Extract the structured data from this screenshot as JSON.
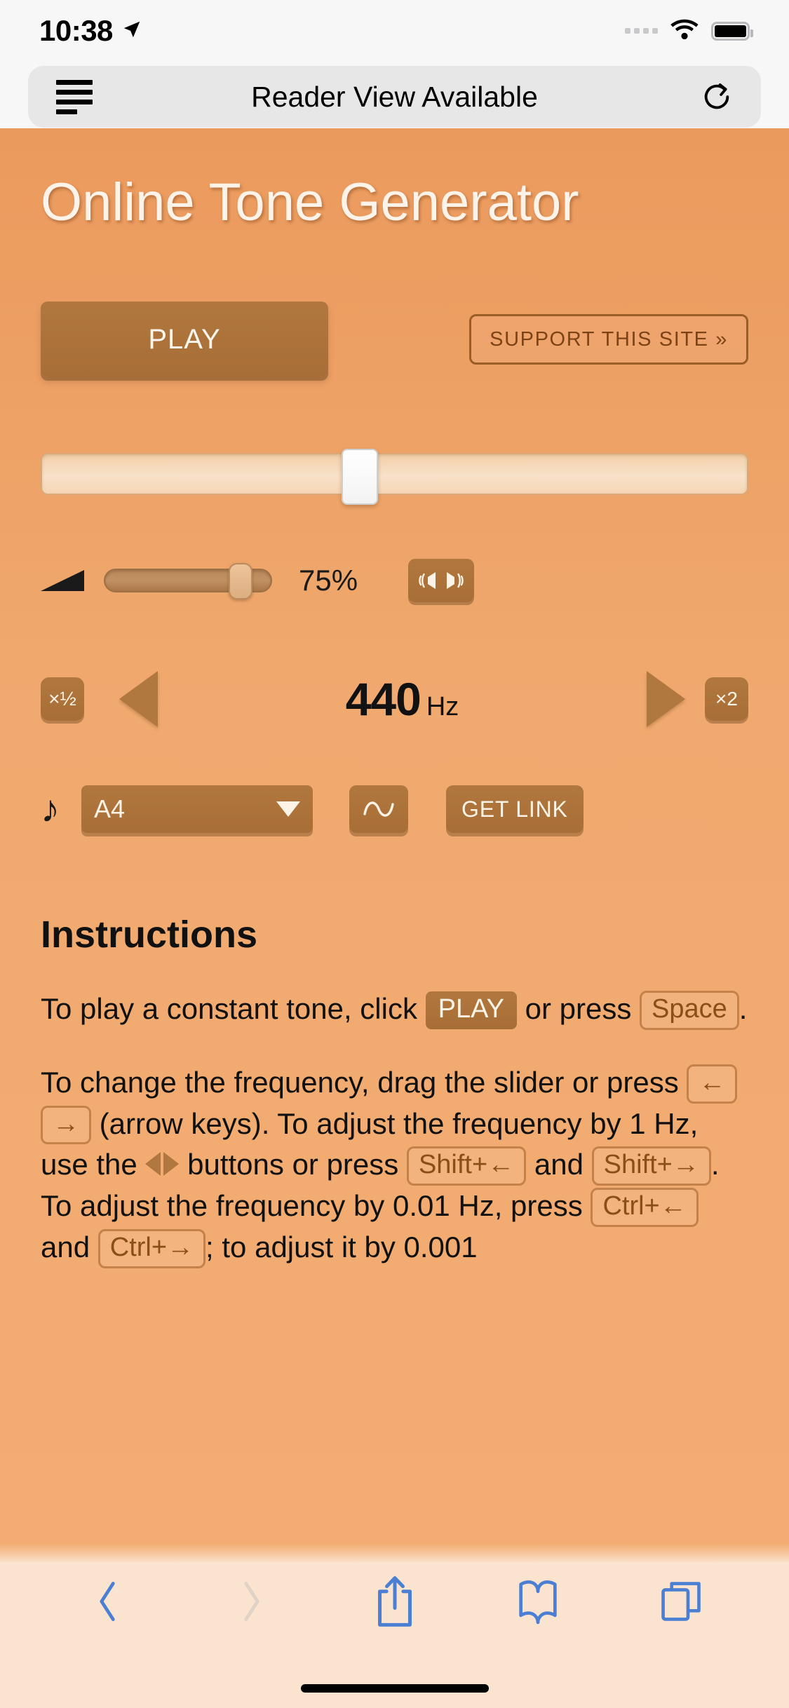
{
  "status_bar": {
    "time": "10:38",
    "location_icon": "location-arrow-icon",
    "signal_icon": "cellular-dots-icon",
    "wifi_icon": "wifi-icon",
    "battery_icon": "battery-full-icon"
  },
  "browser": {
    "top_bar": {
      "reader_icon": "reader-view-icon",
      "title": "Reader View Available",
      "reload_icon": "reload-icon"
    },
    "bottom_bar": {
      "back_icon": "chevron-left-icon",
      "forward_icon": "chevron-right-icon",
      "share_icon": "share-icon",
      "bookmarks_icon": "book-icon",
      "tabs_icon": "tabs-icon",
      "back_enabled": true,
      "forward_enabled": false,
      "accent_color": "#4a7fd4",
      "disabled_color": "#e0d2c4"
    }
  },
  "page": {
    "title": "Online Tone Generator",
    "background_color": "#f0a96e",
    "brown_color": "#a86e37",
    "controls": {
      "play_label": "PLAY",
      "support_label": "SUPPORT THIS SITE »",
      "frequency_slider": {
        "name": "frequency-slider",
        "value_percent": 43
      },
      "volume": {
        "icon": "volume-triangle-icon",
        "value_percent": 75,
        "value_label": "75%",
        "stereo_icon": "stereo-balance-icon"
      },
      "frequency": {
        "halve_label": "×½",
        "decrease_icon": "triangle-left-icon",
        "value": "440",
        "unit": "Hz",
        "increase_icon": "triangle-right-icon",
        "double_label": "×2"
      },
      "note": {
        "icon": "music-note-icon",
        "selected": "A4",
        "caret_icon": "caret-down-icon",
        "waveform_icon": "sine-wave-icon",
        "get_link_label": "GET LINK"
      }
    },
    "instructions": {
      "heading": "Instructions",
      "p1": {
        "t1": "To play a constant tone, click ",
        "k1": "PLAY",
        "t2": " or press ",
        "k2": "Space",
        "t3": "."
      },
      "p2": {
        "t1": "To change the frequency, drag the slider or press ",
        "k1": "←",
        "k2": "→",
        "t2": " (arrow keys). To adjust the frequency by 1 Hz, use the ",
        "t3": " buttons or press ",
        "k3": "Shift+←",
        "t4": " and ",
        "k4": "Shift+→",
        "t5": ". To adjust the frequency by 0.01 Hz, press ",
        "k5": "Ctrl+←",
        "t6": " and ",
        "k6": "Ctrl+→",
        "t7": "; to adjust it by 0.001"
      }
    }
  }
}
